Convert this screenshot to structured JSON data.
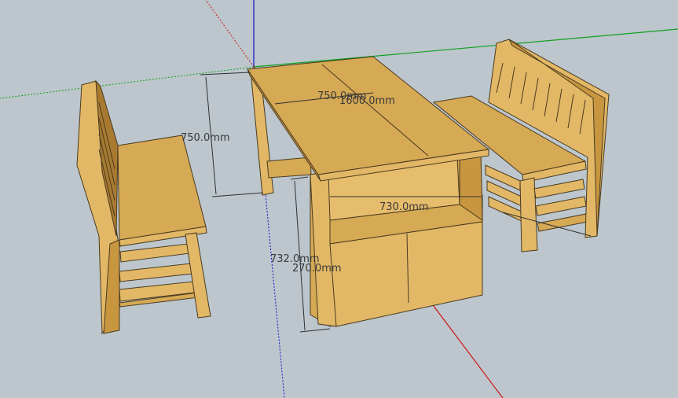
{
  "colors": {
    "background": "#bcc6cc",
    "wood_top": "#d6a955",
    "wood_front": "#e2b866",
    "wood_side": "#c8963f",
    "wood_dark": "#a87a30",
    "edge": "#4a3a20",
    "axis_red": "#d01010",
    "axis_green": "#10a020",
    "axis_blue": "#1010d0",
    "dimension_line": "#303030"
  },
  "dimensions": {
    "table_width": "750.0mm",
    "table_length": "1600.0mm",
    "table_height": "750.0mm",
    "cabinet_width": "730.0mm",
    "cabinet_height": "732.0mm",
    "door_height": "270.0mm"
  },
  "icons": {
    "axes": "model-axes",
    "table": "dining-table-model",
    "bench_left": "bench-left-model",
    "bench_right": "bench-right-model"
  }
}
